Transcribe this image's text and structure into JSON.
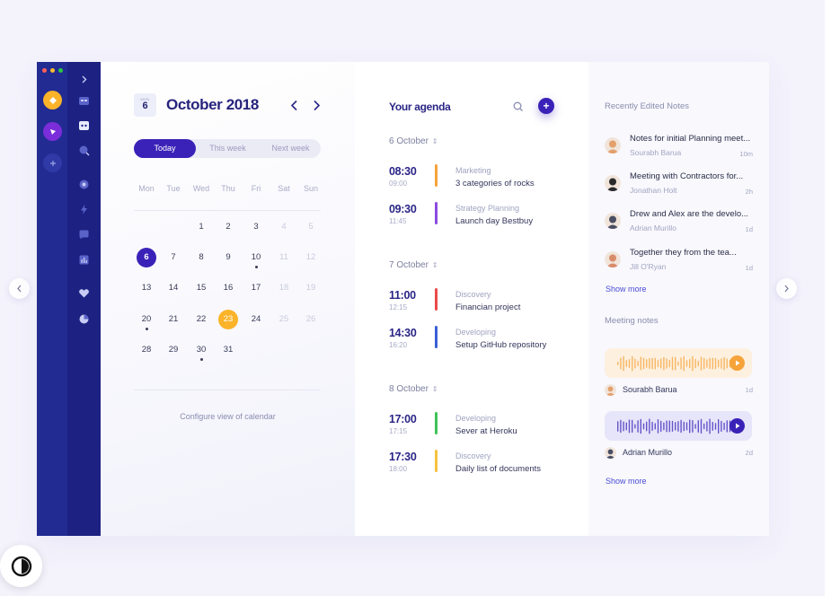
{
  "window_controls": [
    {
      "name": "close",
      "color": "#ff5f57"
    },
    {
      "name": "minimize",
      "color": "#febc2e"
    },
    {
      "name": "maximize",
      "color": "#28c840"
    }
  ],
  "workspaces": [
    {
      "name": "workspace-yellow",
      "color": "#fbb329",
      "icon": "diamond-icon"
    },
    {
      "name": "workspace-purple",
      "color": "#7a2dd9",
      "icon": "play-shape-icon"
    },
    {
      "name": "workspace-add",
      "color": "#2f3aa6",
      "icon": "plus-icon"
    }
  ],
  "sidebar_icons": [
    "chevron-right-icon",
    "dashboard-icon",
    "calendar-robot-icon",
    "search-icon",
    "compass-icon",
    "lightning-icon",
    "chat-icon",
    "chart-icon",
    "heart-icon",
    "pie-icon"
  ],
  "calendar": {
    "badge_month": "MON",
    "badge_day": "6",
    "title": "October 2018",
    "tabs": [
      {
        "label": "Today",
        "active": true
      },
      {
        "label": "This week",
        "active": false
      },
      {
        "label": "Next week",
        "active": false
      }
    ],
    "weekdays": [
      "Mon",
      "Tue",
      "Wed",
      "Thu",
      "Fri",
      "Sat",
      "Sun"
    ],
    "weeks": [
      [
        {
          "d": ""
        },
        {
          "d": ""
        },
        {
          "d": "1"
        },
        {
          "d": "2"
        },
        {
          "d": "3"
        },
        {
          "d": "4",
          "dim": true
        },
        {
          "d": "5",
          "dim": true
        }
      ],
      [
        {
          "d": "6",
          "selected": true
        },
        {
          "d": "7"
        },
        {
          "d": "8"
        },
        {
          "d": "9"
        },
        {
          "d": "10",
          "event": true
        },
        {
          "d": "11",
          "dim": true
        },
        {
          "d": "12",
          "dim": true
        }
      ],
      [
        {
          "d": "13"
        },
        {
          "d": "14"
        },
        {
          "d": "15"
        },
        {
          "d": "16"
        },
        {
          "d": "17"
        },
        {
          "d": "18",
          "dim": true
        },
        {
          "d": "19",
          "dim": true
        }
      ],
      [
        {
          "d": "20",
          "event": true
        },
        {
          "d": "21"
        },
        {
          "d": "22"
        },
        {
          "d": "23",
          "today": true
        },
        {
          "d": "24"
        },
        {
          "d": "25",
          "dim": true
        },
        {
          "d": "26",
          "dim": true
        }
      ],
      [
        {
          "d": "28"
        },
        {
          "d": "29"
        },
        {
          "d": "30",
          "event": true
        },
        {
          "d": "31"
        },
        {
          "d": ""
        },
        {
          "d": ""
        },
        {
          "d": ""
        }
      ]
    ],
    "configure_label": "Configure view of calendar"
  },
  "agenda": {
    "title": "Your agenda",
    "add_label": "+",
    "days": [
      {
        "label": "6 October",
        "events": [
          {
            "start": "08:30",
            "end": "09:00",
            "category": "Marketing",
            "name": "3 categories of rocks",
            "color": "#f6a33a"
          },
          {
            "start": "09:30",
            "end": "11:45",
            "category": "Strategy Planning",
            "name": "Launch day Bestbuy",
            "color": "#8a4be0"
          }
        ]
      },
      {
        "label": "7 October",
        "events": [
          {
            "start": "11:00",
            "end": "12:15",
            "category": "Discovery",
            "name": "Financian project",
            "color": "#ea4a4a"
          },
          {
            "start": "14:30",
            "end": "16:20",
            "category": "Developing",
            "name": "Setup GitHub repository",
            "color": "#3a5fd6"
          }
        ]
      },
      {
        "label": "8 October",
        "events": [
          {
            "start": "17:00",
            "end": "17:15",
            "category": "Developing",
            "name": "Sever at Heroku",
            "color": "#3fc35a"
          },
          {
            "start": "17:30",
            "end": "18:00",
            "category": "Discovery",
            "name": "Daily list of documents",
            "color": "#f6c23e"
          }
        ]
      }
    ]
  },
  "notes": {
    "title": "Recently Edited Notes",
    "items": [
      {
        "title": "Notes for initial Planning meet...",
        "author": "Sourabh Barua",
        "age": "10m",
        "avatar_color": "#e3a06c"
      },
      {
        "title": "Meeting with Contractors for...",
        "author": "Jonathan Holt",
        "age": "2h",
        "avatar_color": "#2a2a2a"
      },
      {
        "title": "Drew and Alex are the develo...",
        "author": "Adrian Murillo",
        "age": "1d",
        "avatar_color": "#4a4f63"
      },
      {
        "title": "Together they from the tea...",
        "author": "Jill O'Ryan",
        "age": "1d",
        "avatar_color": "#d88c6a"
      }
    ],
    "show_more": "Show more",
    "meeting_title": "Meeting notes",
    "meetings": [
      {
        "author": "Sourabh Barua",
        "age": "1d",
        "color": "#f6a33a",
        "bg": "#fdf0df",
        "avatar_color": "#e3a06c"
      },
      {
        "author": "Adrian Murillo",
        "age": "2d",
        "color": "#3a22b8",
        "bg": "#e7e5f9",
        "avatar_color": "#4a4f63"
      }
    ],
    "show_more_2": "Show more"
  }
}
